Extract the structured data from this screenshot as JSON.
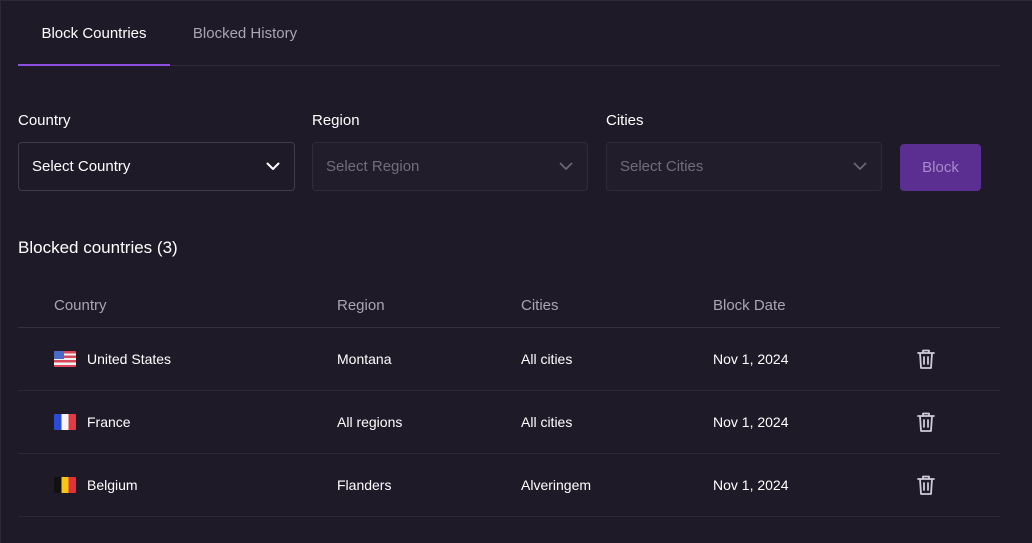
{
  "tabs": [
    {
      "label": "Block Countries",
      "active": true
    },
    {
      "label": "Blocked History",
      "active": false
    }
  ],
  "filters": {
    "country": {
      "label": "Country",
      "placeholder": "Select Country",
      "enabled": true
    },
    "region": {
      "label": "Region",
      "placeholder": "Select Region",
      "enabled": false
    },
    "cities": {
      "label": "Cities",
      "placeholder": "Select Cities",
      "enabled": false
    },
    "block_label": "Block"
  },
  "blocked_section": {
    "title": "Blocked countries (3)"
  },
  "table": {
    "headers": {
      "country": "Country",
      "region": "Region",
      "cities": "Cities",
      "block_date": "Block Date"
    },
    "rows": [
      {
        "flag": "us-flag",
        "country": "United States",
        "region": "Montana",
        "cities": "All cities",
        "block_date": "Nov 1, 2024"
      },
      {
        "flag": "fr-flag",
        "country": "France",
        "region": "All regions",
        "cities": "All cities",
        "block_date": "Nov 1, 2024"
      },
      {
        "flag": "be-flag",
        "country": "Belgium",
        "region": "Flanders",
        "cities": "Alveringem",
        "block_date": "Nov 1, 2024"
      }
    ]
  },
  "colors": {
    "background": "#1e1a28",
    "accent": "#8e4fe0",
    "block_button": "#5a2f91"
  }
}
